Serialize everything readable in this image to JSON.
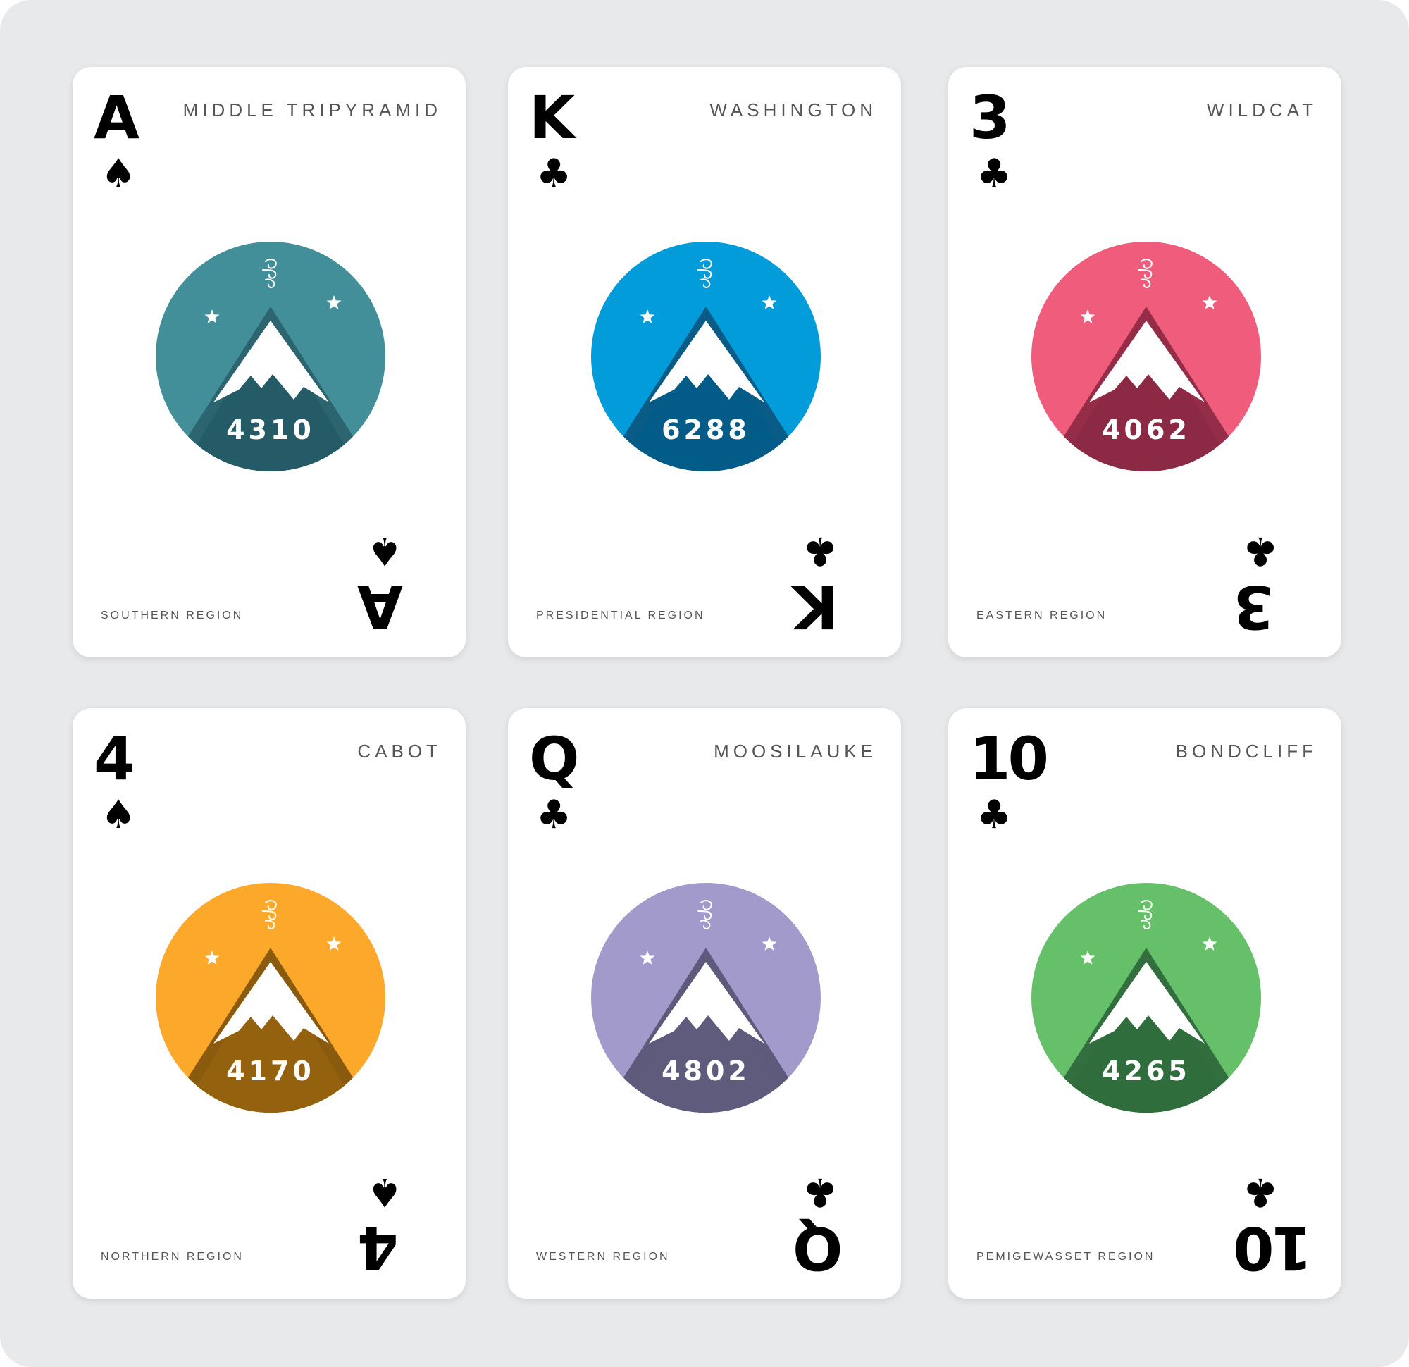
{
  "cards": [
    {
      "rank": "A",
      "suit": "♠",
      "suit_name": "spade-icon",
      "mountain": "MIDDLE TRIPYRAMID",
      "region": "SOUTHERN REGION",
      "elevation": "4310",
      "light": "#428f99",
      "dark": "#245b66",
      "ridge": "#2c6570"
    },
    {
      "rank": "K",
      "suit": "♣",
      "suit_name": "club-icon",
      "mountain": "WASHINGTON",
      "region": "PRESIDENTIAL REGION",
      "elevation": "6288",
      "light": "#029cdb",
      "dark": "#035b88",
      "ridge": "#0a5b85"
    },
    {
      "rank": "3",
      "suit": "♣",
      "suit_name": "club-icon",
      "mountain": "WILDCAT",
      "region": "EASTERN REGION",
      "elevation": "4062",
      "light": "#f05c7b",
      "dark": "#8c2a45",
      "ridge": "#952d48"
    },
    {
      "rank": "4",
      "suit": "♠",
      "suit_name": "spade-icon",
      "mountain": "CABOT",
      "region": "NORTHERN REGION",
      "elevation": "4170",
      "light": "#fba82b",
      "dark": "#94610e",
      "ridge": "#8a5a0e"
    },
    {
      "rank": "Q",
      "suit": "♣",
      "suit_name": "club-icon",
      "mountain": "MOOSILAUKE",
      "region": "WESTERN REGION",
      "elevation": "4802",
      "light": "#a19acb",
      "dark": "#5e5b7d",
      "ridge": "#5d5a7c"
    },
    {
      "rank": "10",
      "suit": "♣",
      "suit_name": "club-icon",
      "mountain": "BONDCLIFF",
      "region": "PEMIGEWASSET REGION",
      "elevation": "4265",
      "light": "#66c06a",
      "dark": "#2f6e3c",
      "ridge": "#336f3e"
    }
  ]
}
